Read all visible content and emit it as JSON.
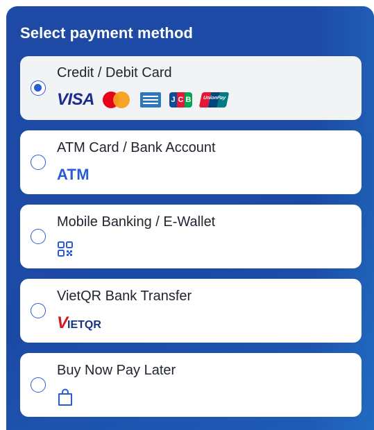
{
  "title": "Select payment method",
  "colors": {
    "panel_blue": "#1e4aa6",
    "accent_blue": "#2a5bd7",
    "selected_bg": "#f2f3f5"
  },
  "options": [
    {
      "label": "Credit / Debit Card",
      "selected": true,
      "icons": [
        "visa-logo",
        "mastercard-logo",
        "amex-logo",
        "jcb-logo",
        "unionpay-logo"
      ],
      "visa_text": "VISA",
      "jcb_letters": [
        "J",
        "C",
        "B"
      ],
      "unionpay_text": "UnionPay"
    },
    {
      "label": "ATM Card / Bank Account",
      "selected": false,
      "icons": [
        "atm-text-icon"
      ],
      "atm_text": "ATM"
    },
    {
      "label": "Mobile Banking / E-Wallet",
      "selected": false,
      "icons": [
        "qr-code-icon"
      ]
    },
    {
      "label": "VietQR Bank Transfer",
      "selected": false,
      "icons": [
        "vietqr-logo"
      ],
      "logo_text": {
        "v": "V",
        "iet": "IET",
        "qr": "QR"
      }
    },
    {
      "label": "Buy Now Pay Later",
      "selected": false,
      "icons": [
        "shopping-bag-icon"
      ]
    }
  ]
}
